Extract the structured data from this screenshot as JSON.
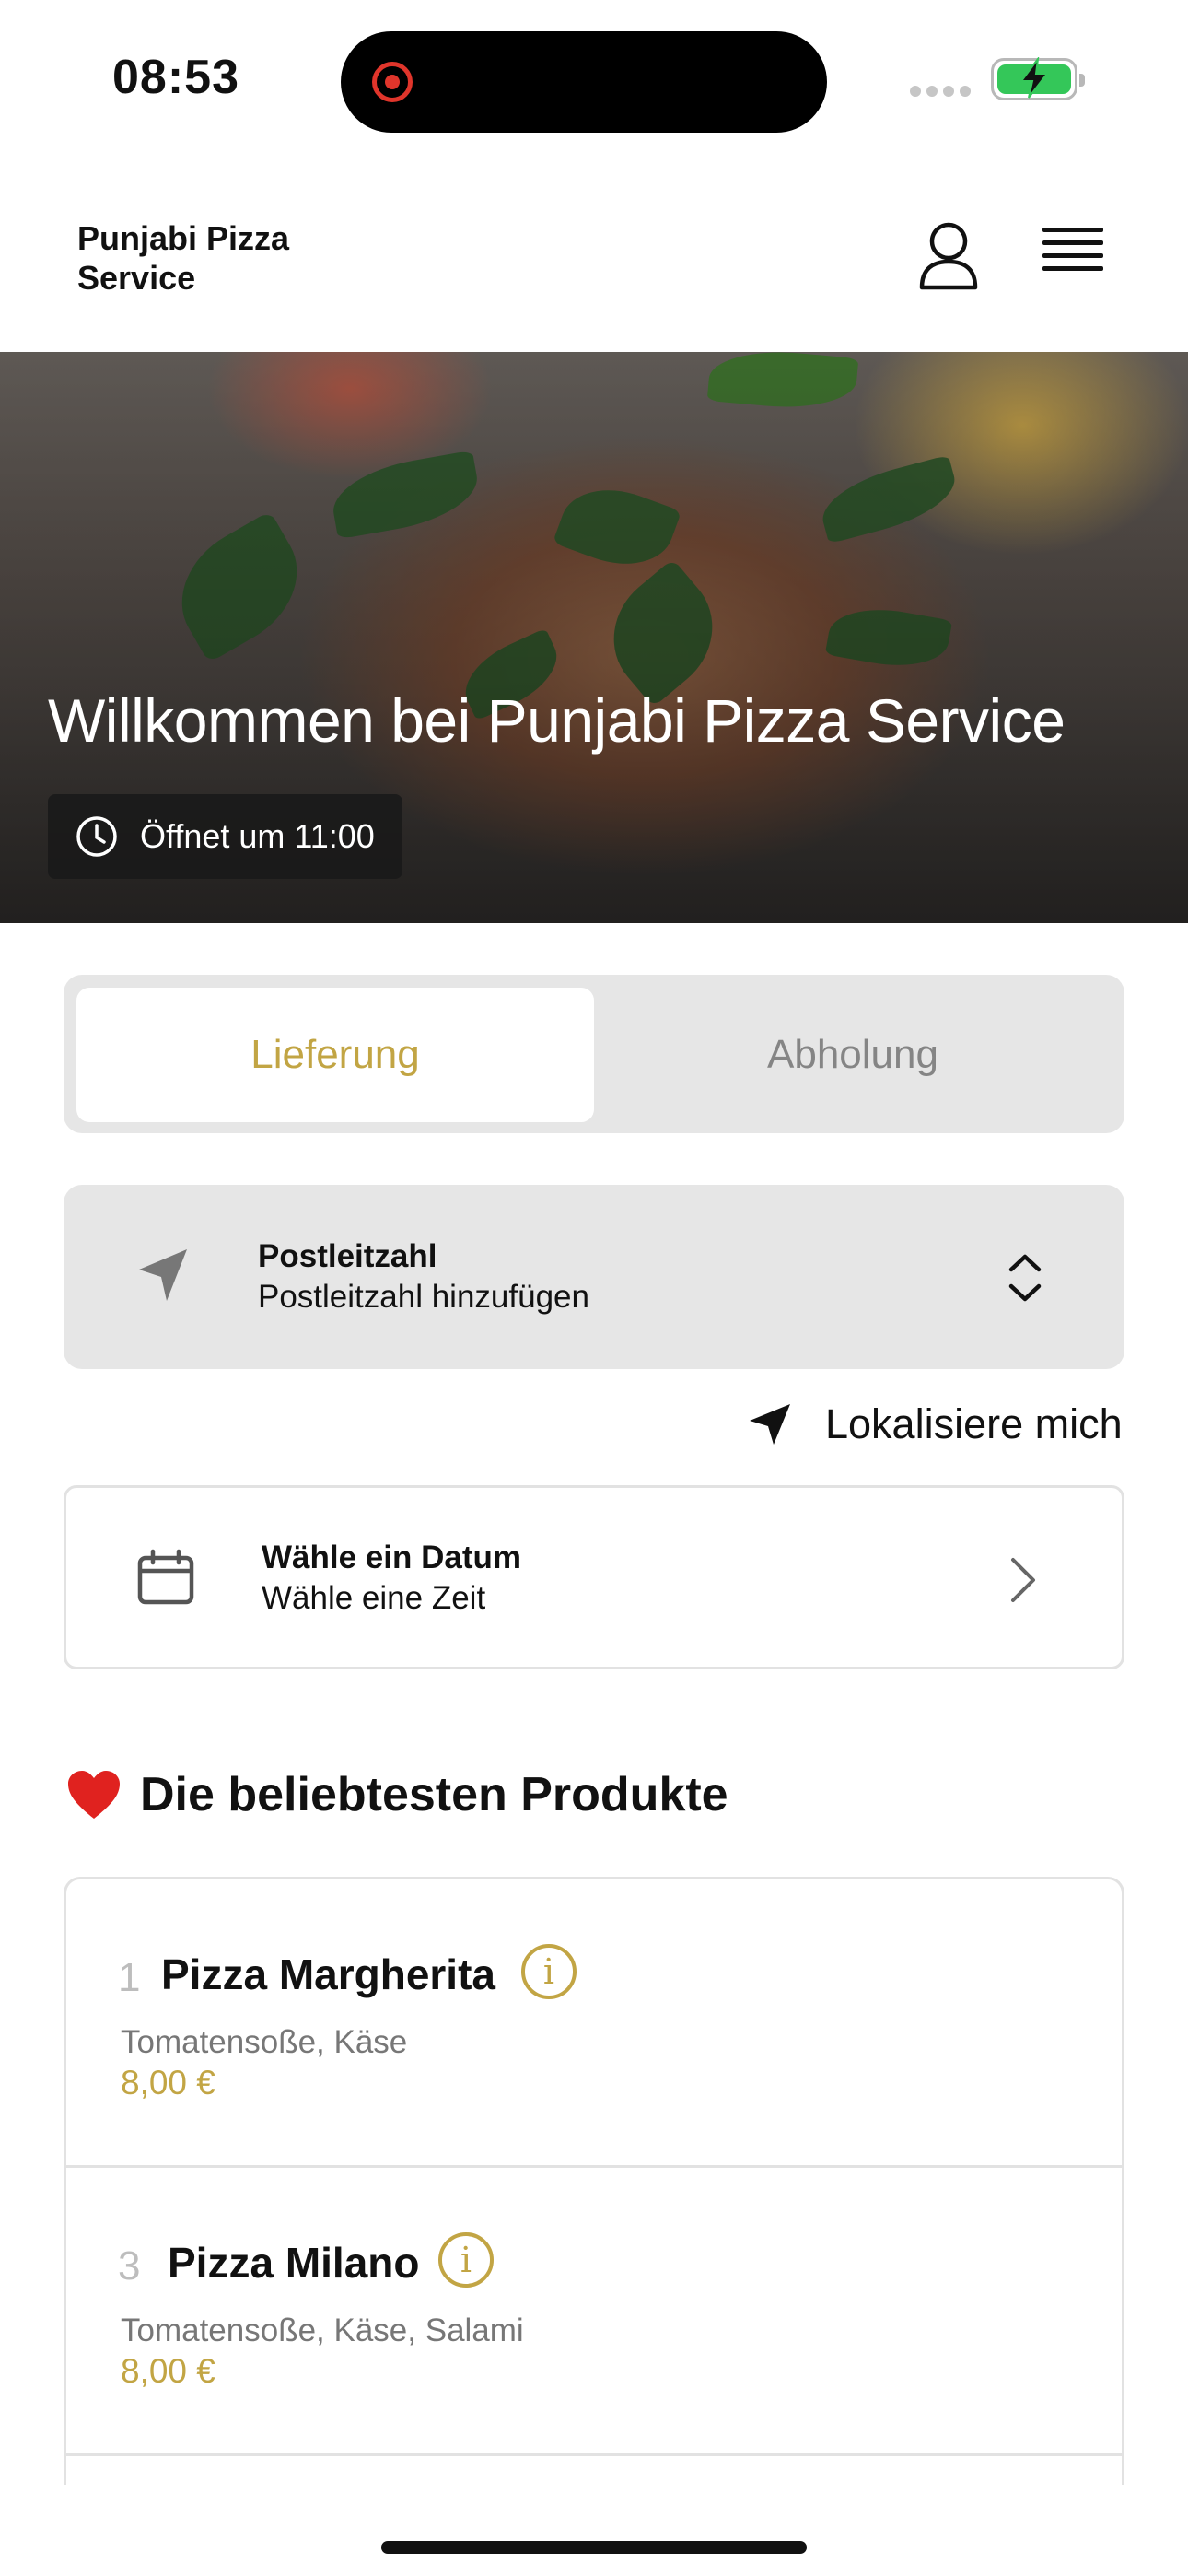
{
  "status_bar": {
    "time": "08:53"
  },
  "header": {
    "brand": "Punjabi Pizza Service",
    "icons": [
      "user-icon",
      "menu-icon"
    ]
  },
  "hero": {
    "title": "Willkommen bei Punjabi Pizza Service",
    "hours": "Öffnet um 11:00"
  },
  "order_mode": {
    "delivery": "Lieferung",
    "pickup": "Abholung",
    "selected": "Lieferung"
  },
  "postal": {
    "label": "Postleitzahl",
    "placeholder": "Postleitzahl hinzufügen"
  },
  "locate": {
    "label": "Lokalisiere mich"
  },
  "date": {
    "label": "Wähle ein Datum",
    "sublabel": "Wähle eine Zeit"
  },
  "popular": {
    "title": "Die beliebtesten Produkte",
    "items": [
      {
        "number": "1",
        "name": "Pizza Margherita",
        "description": "Tomatensoße, Käse",
        "price": "8,00 €"
      },
      {
        "number": "3",
        "name": "Pizza Milano",
        "description": "Tomatensoße, Käse, Salami",
        "price": "8,00 €"
      }
    ]
  },
  "colors": {
    "accent": "#c2a544",
    "panel": "#e6e6e6",
    "muted": "#858585"
  }
}
